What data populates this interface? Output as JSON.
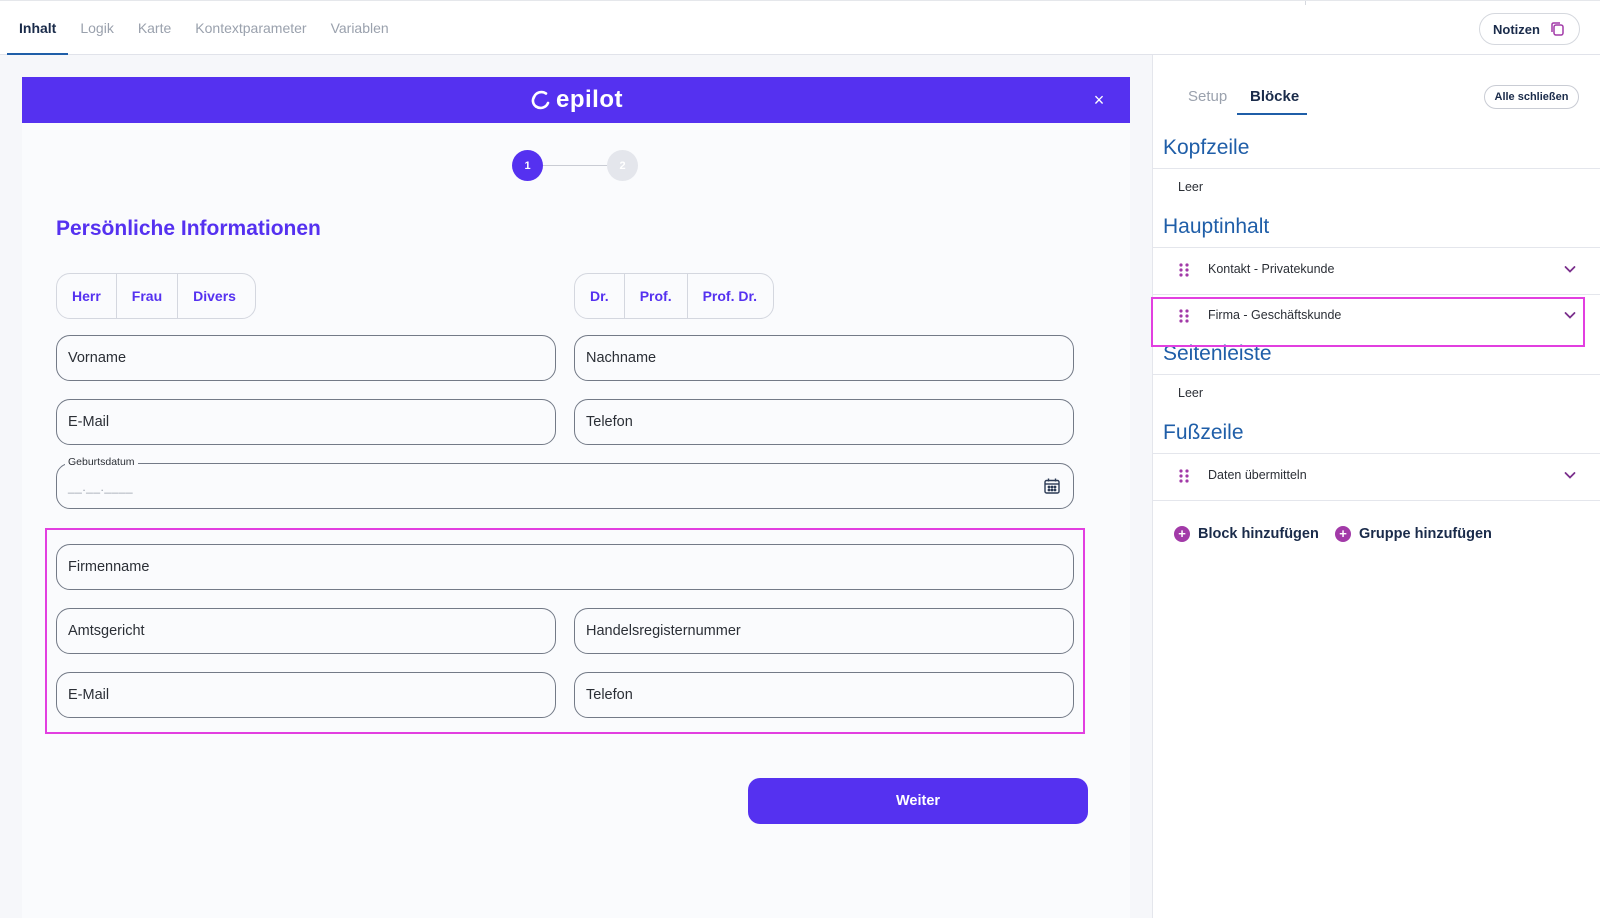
{
  "topnav": {
    "tabs": [
      {
        "label": "Inhalt",
        "active": true
      },
      {
        "label": "Logik",
        "active": false
      },
      {
        "label": "Karte",
        "active": false
      },
      {
        "label": "Kontextparameter",
        "active": false
      },
      {
        "label": "Variablen",
        "active": false
      }
    ],
    "notes_label": "Notizen"
  },
  "journey": {
    "brand": "epilot",
    "close_icon": "×",
    "steps": [
      "1",
      "2"
    ],
    "current_step": 1,
    "title": "Persönliche Informationen",
    "salutations": [
      "Herr",
      "Frau",
      "Divers"
    ],
    "titles": [
      "Dr.",
      "Prof.",
      "Prof. Dr."
    ],
    "fields": {
      "first_name": "Vorname",
      "last_name": "Nachname",
      "email": "E-Mail",
      "phone": "Telefon",
      "birthdate_label": "Geburtsdatum",
      "birthdate_mask": "__.__.____",
      "company_name": "Firmenname",
      "court": "Amtsgericht",
      "register_number": "Handelsregisternummer",
      "company_email": "E-Mail",
      "company_phone": "Telefon"
    },
    "next_label": "Weiter",
    "colors": {
      "brand": "#5531f0",
      "highlight": "#e23fe0"
    }
  },
  "panel": {
    "tabs": [
      {
        "label": "Setup",
        "active": false
      },
      {
        "label": "Blöcke",
        "active": true
      }
    ],
    "close_all_label": "Alle schließen",
    "sections": {
      "header": {
        "title": "Kopfzeile",
        "empty": "Leer"
      },
      "main": {
        "title": "Hauptinhalt",
        "blocks": [
          "Kontakt - Privatekunde",
          "Firma - Geschäftskunde"
        ]
      },
      "sidebar": {
        "title": "Seitenleiste",
        "empty": "Leer"
      },
      "footer": {
        "title": "Fußzeile",
        "blocks": [
          "Daten übermitteln"
        ]
      }
    },
    "add_block_label": "Block hinzufügen",
    "add_group_label": "Gruppe hinzufügen",
    "icons": {
      "drag": "drag-handle-icon",
      "expand": "chevron-down-icon",
      "add": "plus-circle-icon"
    }
  }
}
